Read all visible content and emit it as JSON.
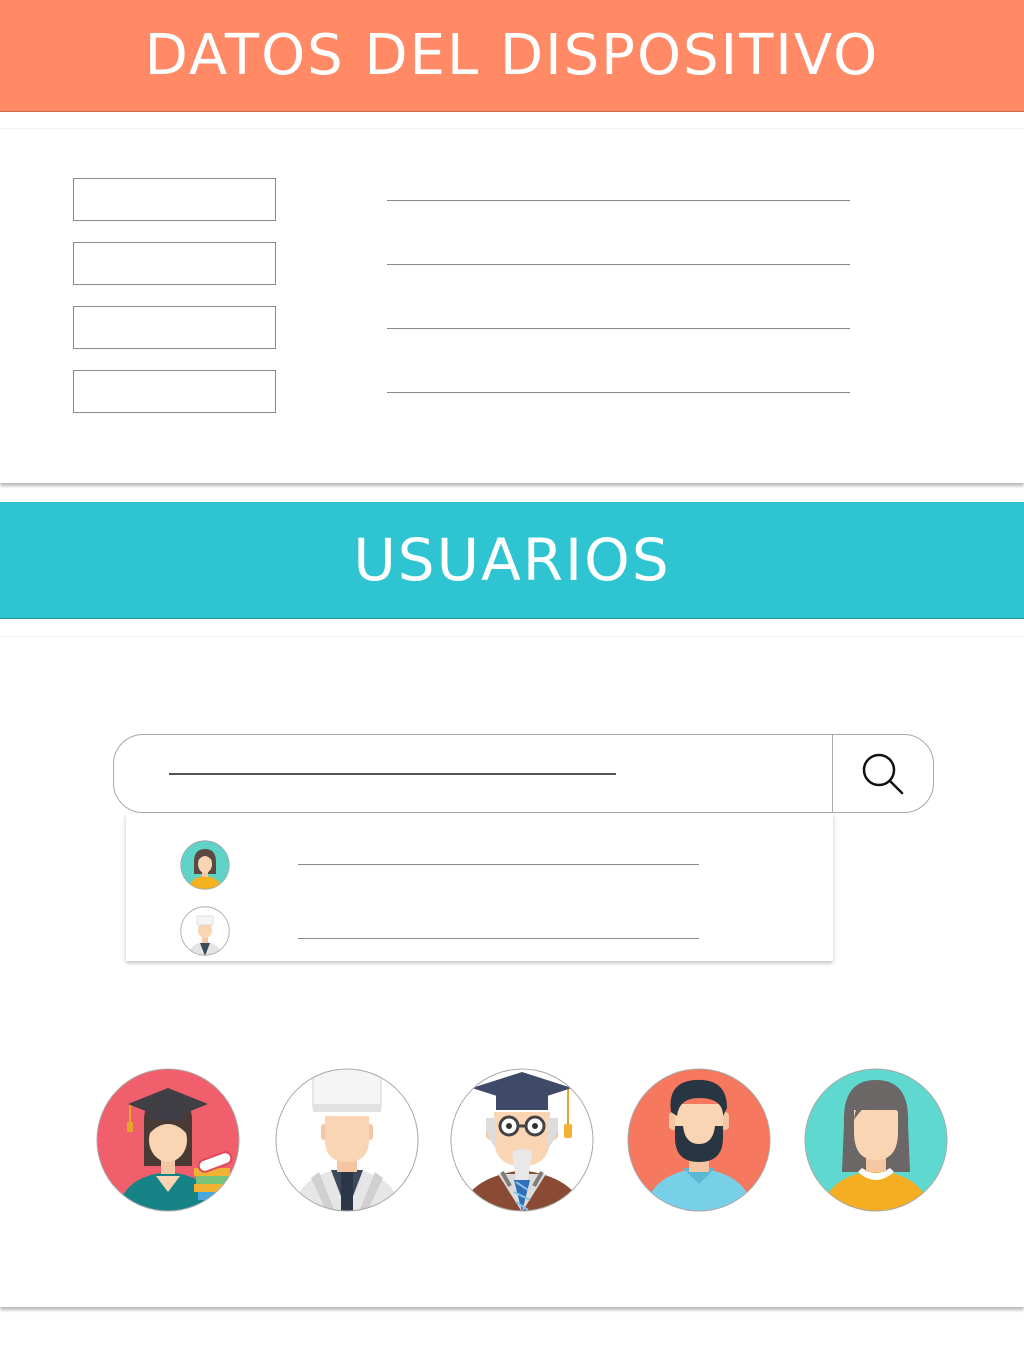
{
  "device_section": {
    "title": "DATOS DEL DISPOSITIVO",
    "fields": [
      {
        "label": "",
        "value": ""
      },
      {
        "label": "",
        "value": ""
      },
      {
        "label": "",
        "value": ""
      },
      {
        "label": "",
        "value": ""
      }
    ]
  },
  "users_section": {
    "title": "USUARIOS",
    "search": {
      "value": "",
      "button_icon": "search-icon"
    },
    "suggestions": [
      {
        "avatar_icon": "woman-avatar-icon",
        "name": ""
      },
      {
        "avatar_icon": "chef-avatar-icon",
        "name": ""
      }
    ],
    "avatars": [
      {
        "icon": "graduate-woman-avatar-icon"
      },
      {
        "icon": "chef-avatar-icon"
      },
      {
        "icon": "professor-avatar-icon"
      },
      {
        "icon": "bearded-man-avatar-icon"
      },
      {
        "icon": "woman-avatar-icon"
      }
    ]
  },
  "colors": {
    "device_header": "#ff8a65",
    "users_header": "#2ec4d1"
  }
}
